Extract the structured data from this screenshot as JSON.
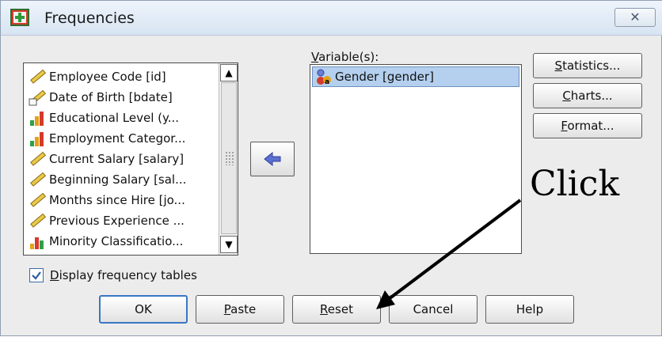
{
  "window": {
    "title": "Frequencies",
    "close_glyph": "✕"
  },
  "source_list": {
    "items": [
      {
        "label": "Employee Code [id]",
        "icon": "scale-ruler-icon"
      },
      {
        "label": "Date of Birth [bdate]",
        "icon": "date-ruler-icon"
      },
      {
        "label": "Educational Level (y...",
        "icon": "ordinal-bar-icon"
      },
      {
        "label": "Employment Categor...",
        "icon": "ordinal-bar-icon"
      },
      {
        "label": "Current Salary [salary]",
        "icon": "scale-ruler-icon"
      },
      {
        "label": "Beginning Salary [sal...",
        "icon": "scale-ruler-icon"
      },
      {
        "label": "Months since Hire [jo...",
        "icon": "scale-ruler-icon"
      },
      {
        "label": "Previous Experience ...",
        "icon": "scale-ruler-icon"
      },
      {
        "label": "Minority Classificatio...",
        "icon": "nominal-bar-icon"
      }
    ],
    "scroll_up": "▲",
    "scroll_down": "▼"
  },
  "variables": {
    "label_first": "V",
    "label_rest": "ariable(s):",
    "items": [
      {
        "label": "Gender [gender]",
        "icon": "nominal-people-icon"
      }
    ]
  },
  "side_buttons": [
    {
      "first": "S",
      "rest": "tatistics..."
    },
    {
      "first": "C",
      "rest": "harts..."
    },
    {
      "first": "F",
      "rest": "ormat..."
    }
  ],
  "checkbox": {
    "first": "D",
    "rest": "isplay frequency tables",
    "checked": true
  },
  "bottom_buttons": {
    "ok": "OK",
    "paste_first": "P",
    "paste_rest": "aste",
    "reset_first": "R",
    "reset_rest": "eset",
    "cancel": "Cancel",
    "help": "Help"
  },
  "annotation": {
    "text": "Click"
  },
  "colors": {
    "selection": "#b4d0ee",
    "accent": "#3a76c4",
    "move_arrow": "#5a6fd0"
  }
}
